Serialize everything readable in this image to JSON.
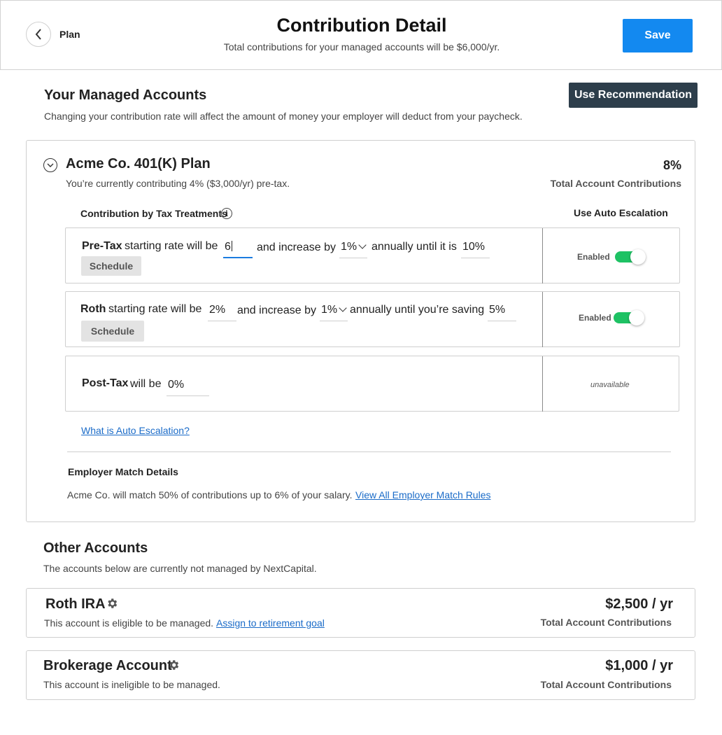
{
  "header": {
    "back_label": "Plan",
    "title": "Contribution Detail",
    "subtitle": "Total contributions for your managed accounts will be $6,000/yr.",
    "save_label": "Save"
  },
  "managed": {
    "title": "Your Managed Accounts",
    "description": "Changing your contribution rate will affect the amount of money your employer will deduct from your paycheck.",
    "recommendation_label": "Use Recommendation"
  },
  "plan": {
    "name": "Acme Co. 401(K) Plan",
    "status": "You’re currently contributing 4% ($3,000/yr) pre-tax.",
    "total_pct": "8%",
    "total_label": "Total Account Contributions",
    "tax_header": "Contribution by Tax Treatments",
    "escalation_header": "Use Auto Escalation",
    "rows": [
      {
        "type": "Pre-Tax",
        "text_start": "starting rate will be",
        "rate": "6",
        "text_increase": "and increase by",
        "increase": "1%",
        "text_until": "annually until it is",
        "target": "10%",
        "schedule_label": "Schedule",
        "escalation_label": "Enabled",
        "escalation_on": true
      },
      {
        "type": "Roth",
        "text_start": "starting rate will be",
        "rate": "2%",
        "text_increase": "and increase by",
        "increase": "1%",
        "text_until": "annually until you’re saving",
        "target": "5%",
        "schedule_label": "Schedule",
        "escalation_label": "Enabled",
        "escalation_on": true
      },
      {
        "type": "Post-Tax",
        "text_start": "will be",
        "rate": "0%",
        "escalation_label": "unavailable"
      }
    ],
    "auto_escalation_link": "What is Auto Escalation?",
    "employer_match_title": "Employer Match Details",
    "employer_match_text": "Acme Co. will match 50% of contributions up to 6% of your salary.",
    "employer_match_link": "View All Employer Match Rules"
  },
  "other": {
    "title": "Other Accounts",
    "description": "The accounts below are currently not managed by NextCapital.",
    "accounts": [
      {
        "name": "Roth IRA",
        "description": "This account is eligible to be managed.",
        "link": "Assign to retirement goal",
        "amount": "$2,500 / yr",
        "amount_label": "Total Account Contributions"
      },
      {
        "name": "Brokerage Account",
        "description": "This account is ineligible to be managed.",
        "amount": "$1,000 / yr",
        "amount_label": "Total Account Contributions"
      }
    ]
  },
  "colors": {
    "primary": "#1389f0",
    "dark_button": "#2d3e4b",
    "toggle_on": "#1ec264",
    "link": "#1a6bc8"
  }
}
